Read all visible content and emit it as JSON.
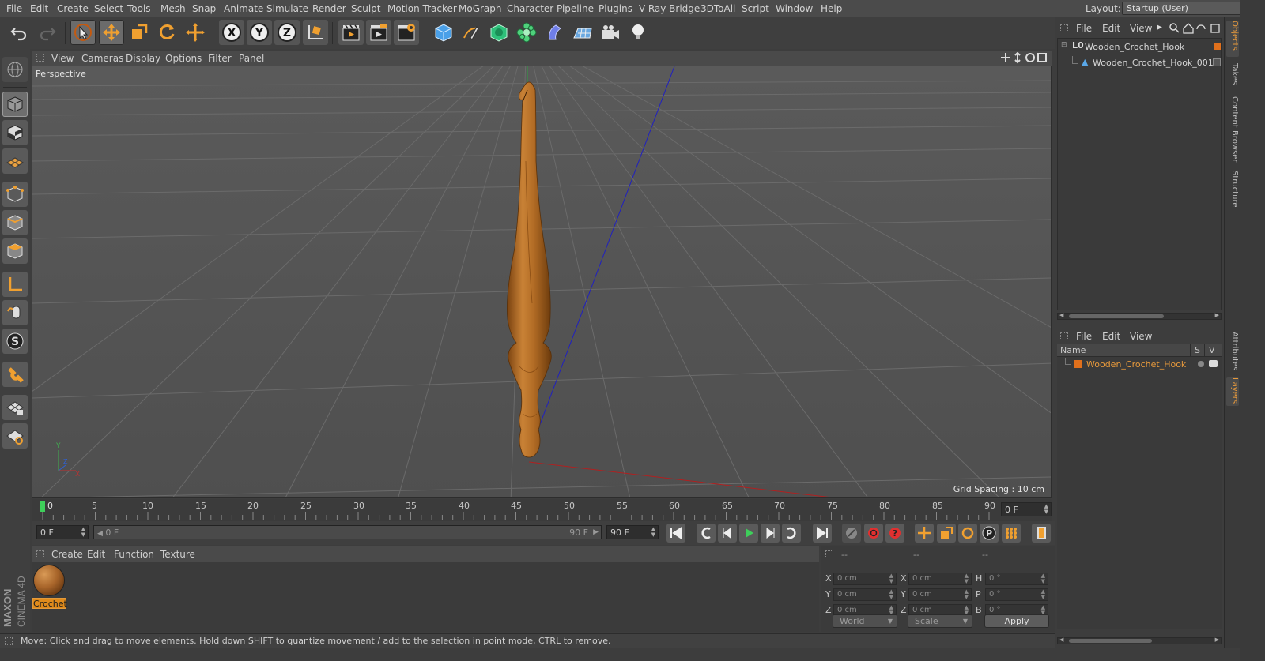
{
  "menubar": {
    "items": [
      "File",
      "Edit",
      "Create",
      "Select",
      "Tools",
      "Mesh",
      "Snap",
      "Animate",
      "Simulate",
      "Render",
      "Sculpt",
      "Motion Tracker",
      "MoGraph",
      "Character",
      "Pipeline",
      "Plugins",
      "V-Ray Bridge",
      "3DToAll",
      "Script",
      "Window",
      "Help"
    ],
    "layout_label": "Layout:",
    "layout_value": "Startup (User)"
  },
  "viewport": {
    "menu": [
      "View",
      "Cameras",
      "Display",
      "Options",
      "Filter",
      "Panel"
    ],
    "label": "Perspective",
    "grid_spacing": "Grid Spacing : 10 cm"
  },
  "timeline": {
    "ticks": [
      "0",
      "5",
      "10",
      "15",
      "20",
      "25",
      "30",
      "35",
      "40",
      "45",
      "50",
      "55",
      "60",
      "65",
      "70",
      "75",
      "80",
      "85",
      "90"
    ],
    "end_field": "0 F"
  },
  "playbar": {
    "current_frame": "0 F",
    "range_start": "0 F",
    "range_end": "90 F",
    "max_frame": "90 F"
  },
  "material_manager": {
    "menu": [
      "Create",
      "Edit",
      "Function",
      "Texture"
    ],
    "material_name": "Crochet"
  },
  "coordinates": {
    "headers": [
      "--",
      "--",
      "--"
    ],
    "rows": [
      {
        "a_label": "X",
        "a_value": "0 cm",
        "b_label": "X",
        "b_value": "0 cm",
        "c_label": "H",
        "c_value": "0 °"
      },
      {
        "a_label": "Y",
        "a_value": "0 cm",
        "b_label": "Y",
        "b_value": "0 cm",
        "c_label": "P",
        "c_value": "0 °"
      },
      {
        "a_label": "Z",
        "a_value": "0 cm",
        "b_label": "Z",
        "b_value": "0 cm",
        "c_label": "B",
        "c_value": "0 °"
      }
    ],
    "space": "World",
    "mode": "Scale",
    "apply": "Apply"
  },
  "brand": {
    "maxon": "MAXON",
    "product": "CINEMA 4D"
  },
  "status": "Move: Click and drag to move elements. Hold down SHIFT to quantize movement / add to the selection in point mode, CTRL to remove.",
  "objects_panel": {
    "menu": [
      "File",
      "Edit",
      "View"
    ],
    "items": [
      "Wooden_Crochet_Hook",
      "Wooden_Crochet_Hook_001"
    ]
  },
  "layers_panel": {
    "menu": [
      "File",
      "Edit",
      "View"
    ],
    "col_name": "Name",
    "col_s": "S",
    "col_v": "V",
    "layer": "Wooden_Crochet_Hook",
    "layer_color": "#e0701c"
  },
  "side_tabs": [
    "Objects",
    "Takes",
    "Content Browser",
    "Structure",
    "Attributes",
    "Layers"
  ],
  "colors": {
    "accent": "#e89a3c",
    "selection": "#e08b1c",
    "wood": "#b8742e"
  }
}
